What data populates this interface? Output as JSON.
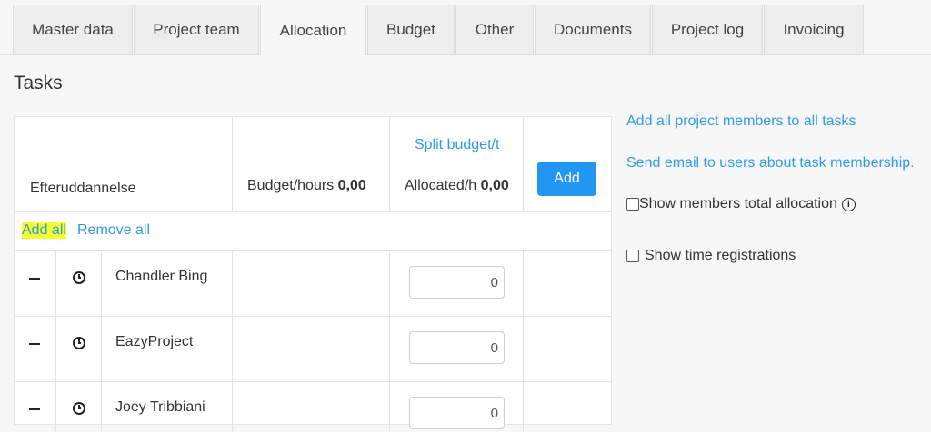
{
  "tabs": [
    {
      "label": "Master data"
    },
    {
      "label": "Project team"
    },
    {
      "label": "Allocation"
    },
    {
      "label": "Budget"
    },
    {
      "label": "Other"
    },
    {
      "label": "Documents"
    },
    {
      "label": "Project log"
    },
    {
      "label": "Invoicing"
    }
  ],
  "active_tab": "Allocation",
  "page": {
    "heading": "Tasks"
  },
  "task": {
    "name": "Efteruddannelse",
    "budget_label": "Budget/hours",
    "budget_value": "0,00",
    "split_budget_link": "Split budget/t",
    "allocated_label": "Allocated/h",
    "allocated_value": "0,00",
    "add_button": "Add",
    "add_all_link": "Add all",
    "remove_all_link": "Remove all"
  },
  "members": [
    {
      "name": "Chandler Bing",
      "allocation": "0"
    },
    {
      "name": "EazyProject",
      "allocation": "0"
    },
    {
      "name": "Joey Tribbiani",
      "allocation": "0"
    }
  ],
  "side": {
    "add_all_members_link": "Add all project members to all tasks",
    "send_email_link": "Send email to users about task membership.",
    "show_total_allocation": {
      "label": "Show members total allocation",
      "checked": false
    },
    "show_time_registrations": {
      "label": "Show time registrations",
      "checked": false
    }
  },
  "colors": {
    "accent": "#2196f3",
    "link": "#2e9bea",
    "highlight": "#f4ff2b"
  }
}
